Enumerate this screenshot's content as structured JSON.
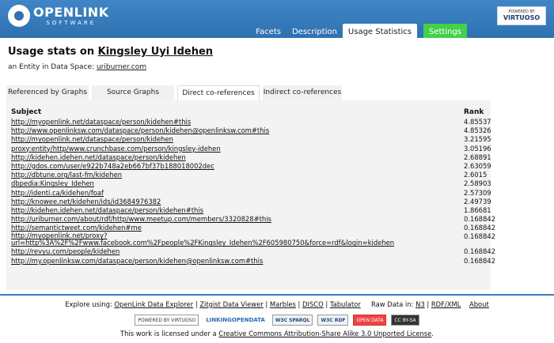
{
  "header": {
    "logo_line1": "OPENLINK",
    "logo_line2": "SOFTWARE",
    "badge_top": "POWERED BY",
    "badge_name": "VIRTUOSO",
    "nav": [
      {
        "label": "Facets"
      },
      {
        "label": "Description"
      },
      {
        "label": "Usage Statistics"
      },
      {
        "label": "Settings"
      }
    ]
  },
  "title": {
    "prefix": "Usage stats on ",
    "entity": "Kingsley Uyi Idehen"
  },
  "entity_line": {
    "prefix": "an Entity in Data Space: ",
    "space": "uriburner.com"
  },
  "tabs": [
    {
      "label": "Referenced by Graphs"
    },
    {
      "label": "Source Graphs"
    },
    {
      "label": "Direct co-references"
    },
    {
      "label": "Indirect co-references"
    }
  ],
  "table": {
    "headers": {
      "subject": "Subject",
      "rank": "Rank"
    },
    "rows": [
      {
        "subject": "http://myopenlink.net/dataspace/person/kidehen#this",
        "rank": "4.85537"
      },
      {
        "subject": "http://www.openlinksw.com/dataspace/person/kidehen@openlinksw.com#this",
        "rank": "4.85326"
      },
      {
        "subject": "http://myopenlink.net/dataspace/person/kidehen",
        "rank": "3.21595"
      },
      {
        "subject": "proxy:entity/http/www.crunchbase.com/person/kingsley-idehen",
        "rank": "3.05196"
      },
      {
        "subject": "http://kidehen.idehen.net/dataspace/person/kidehen",
        "rank": "2.68891"
      },
      {
        "subject": "http://gdos.com/user/e922b748a2eb667bf37b188018002dec",
        "rank": "2.63059"
      },
      {
        "subject": "http://dbtune.org/last-fm/kidehen",
        "rank": "2.6015"
      },
      {
        "subject": "dbpedia:Kingsley_Idehen",
        "rank": "2.58903"
      },
      {
        "subject": "http://identi.ca/kidehen/foaf",
        "rank": "2.57309"
      },
      {
        "subject": "http://knowee.net/kidehen/ids/id3684976382",
        "rank": "2.49739"
      },
      {
        "subject": "http://kidehen.idehen.net/dataspace/person/kidehen#this",
        "rank": "1.86681"
      },
      {
        "subject": "http://uriburner.com/about/rdf/http/www.meetup.com/members/3320828#this",
        "rank": "0.168842"
      },
      {
        "subject": "http://semantictweet.com/kidehen#me",
        "rank": "0.168842"
      },
      {
        "subject": "http://myopenlink.net/proxy?url=http%3A%2F%2Fwww.facebook.com%2Fpeople%2FKingsley_Idehen%2F605980750&force=rdf&login=kidehen",
        "rank": "0.168842"
      },
      {
        "subject": "http://revyu.com/people/kidehen",
        "rank": "0.168842"
      },
      {
        "subject": "http://my.openlinksw.com/dataspace/person/kidehen@openlinksw.com#this",
        "rank": "0.168842"
      }
    ]
  },
  "footer": {
    "explore_label": "Explore using:",
    "explore_links": [
      "OpenLink Data Explorer",
      "Zitgist Data Viewer",
      "Marbles",
      "DISCO",
      "Tabulator"
    ],
    "raw_label": "Raw Data in:",
    "raw_links": [
      "N3",
      "RDF/XML"
    ],
    "about": "About",
    "badges": [
      {
        "text": "POWERED BY VIRTUOSO"
      },
      {
        "text": "LINKINGOPENDATA"
      },
      {
        "text": "W3C SPARQL"
      },
      {
        "text": "W3C RDF"
      },
      {
        "text": "OPEN DATA"
      },
      {
        "text": "CC BY-SA"
      }
    ],
    "license_prefix": "This work is licensed under a ",
    "license_link": "Creative Commons Attribution-Share Alike 3.0 Unported License",
    "license_suffix": "."
  }
}
